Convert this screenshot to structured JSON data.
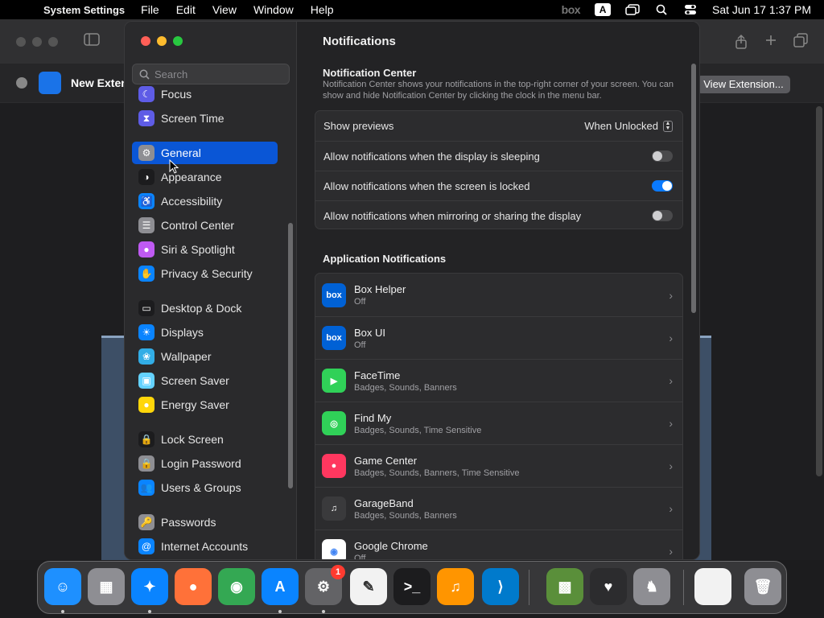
{
  "menubar": {
    "app_name": "System Settings",
    "items": [
      "File",
      "Edit",
      "View",
      "Window",
      "Help"
    ],
    "box_label": "box",
    "input_label": "A",
    "datetime": "Sat Jun 17  1:37 PM"
  },
  "background_window": {
    "tab_title": "New Exten",
    "view_extension_label": "View Extension..."
  },
  "settings": {
    "search_placeholder": "Search",
    "sidebar": [
      {
        "label": "Focus",
        "color": "#5e5ce6",
        "glyph": "☾"
      },
      {
        "label": "Screen Time",
        "color": "#5e5ce6",
        "glyph": "⧗"
      },
      {
        "label": "General",
        "color": "#8e8e93",
        "glyph": "⚙",
        "selected": true
      },
      {
        "label": "Appearance",
        "color": "#1c1c1e",
        "glyph": "◑"
      },
      {
        "label": "Accessibility",
        "color": "#0a84ff",
        "glyph": "♿"
      },
      {
        "label": "Control Center",
        "color": "#8e8e93",
        "glyph": "☰"
      },
      {
        "label": "Siri & Spotlight",
        "color": "#bf5af2",
        "glyph": "●"
      },
      {
        "label": "Privacy & Security",
        "color": "#0a84ff",
        "glyph": "✋"
      },
      {
        "label": "Desktop & Dock",
        "color": "#1c1c1e",
        "glyph": "▭"
      },
      {
        "label": "Displays",
        "color": "#0a84ff",
        "glyph": "☀"
      },
      {
        "label": "Wallpaper",
        "color": "#32ade6",
        "glyph": "❀"
      },
      {
        "label": "Screen Saver",
        "color": "#64d2ff",
        "glyph": "▣"
      },
      {
        "label": "Energy Saver",
        "color": "#ffd60a",
        "glyph": "●"
      },
      {
        "label": "Lock Screen",
        "color": "#1c1c1e",
        "glyph": "🔒"
      },
      {
        "label": "Login Password",
        "color": "#8e8e93",
        "glyph": "🔒"
      },
      {
        "label": "Users & Groups",
        "color": "#0a84ff",
        "glyph": "👥"
      },
      {
        "label": "Passwords",
        "color": "#8e8e93",
        "glyph": "🔑"
      },
      {
        "label": "Internet Accounts",
        "color": "#0a84ff",
        "glyph": "@"
      }
    ],
    "main": {
      "title": "Notifications",
      "nc_title": "Notification Center",
      "nc_desc": "Notification Center shows your notifications in the top-right corner of your screen. You can show and hide Notification Center by clicking the clock in the menu bar.",
      "show_previews_label": "Show previews",
      "show_previews_value": "When Unlocked",
      "toggles": [
        {
          "label": "Allow notifications when the display is sleeping",
          "on": false
        },
        {
          "label": "Allow notifications when the screen is locked",
          "on": true
        },
        {
          "label": "Allow notifications when mirroring or sharing the display",
          "on": false
        }
      ],
      "app_section_title": "Application Notifications",
      "apps": [
        {
          "name": "Box Helper",
          "sub": "Off",
          "color": "#0061d5",
          "glyph": "box"
        },
        {
          "name": "Box UI",
          "sub": "Off",
          "color": "#0061d5",
          "glyph": "box"
        },
        {
          "name": "FaceTime",
          "sub": "Badges, Sounds, Banners",
          "color": "#30d158",
          "glyph": "▶"
        },
        {
          "name": "Find My",
          "sub": "Badges, Sounds, Time Sensitive",
          "color": "#30d158",
          "glyph": "◎"
        },
        {
          "name": "Game Center",
          "sub": "Badges, Sounds, Banners, Time Sensitive",
          "color": "#ff375f",
          "glyph": "●"
        },
        {
          "name": "GarageBand",
          "sub": "Badges, Sounds, Banners",
          "color": "#3a3a3c",
          "glyph": "♫"
        },
        {
          "name": "Google Chrome",
          "sub": "Off",
          "color": "#ffffff",
          "glyph": "◉"
        }
      ]
    }
  },
  "dock": {
    "items": [
      {
        "name": "finder",
        "color": "#1e90ff",
        "glyph": "☺"
      },
      {
        "name": "launchpad",
        "color": "#8e8e93",
        "glyph": "▦"
      },
      {
        "name": "safari",
        "color": "#0a84ff",
        "glyph": "✦"
      },
      {
        "name": "firefox",
        "color": "#ff7139",
        "glyph": "●"
      },
      {
        "name": "chrome",
        "color": "#34a853",
        "glyph": "◉"
      },
      {
        "name": "app-store",
        "color": "#0a84ff",
        "glyph": "A"
      },
      {
        "name": "system-settings",
        "color": "#636366",
        "glyph": "⚙",
        "badge": "1"
      },
      {
        "name": "textedit",
        "color": "#f2f2f2",
        "glyph": "✎"
      },
      {
        "name": "terminal",
        "color": "#1c1c1e",
        "glyph": ">_"
      },
      {
        "name": "garageband",
        "color": "#ff9500",
        "glyph": "♫"
      },
      {
        "name": "vscode",
        "color": "#007acc",
        "glyph": "⟩"
      },
      {
        "name": "minecraft",
        "color": "#5a8f3a",
        "glyph": "▩"
      },
      {
        "name": "pixel-heart",
        "color": "#2c2c2e",
        "glyph": "♥"
      },
      {
        "name": "chess",
        "color": "#8e8e93",
        "glyph": "♞"
      },
      {
        "name": "preview-window",
        "color": "#f2f2f2",
        "glyph": ""
      },
      {
        "name": "trash",
        "color": "#8e8e93",
        "glyph": "🗑"
      }
    ]
  }
}
